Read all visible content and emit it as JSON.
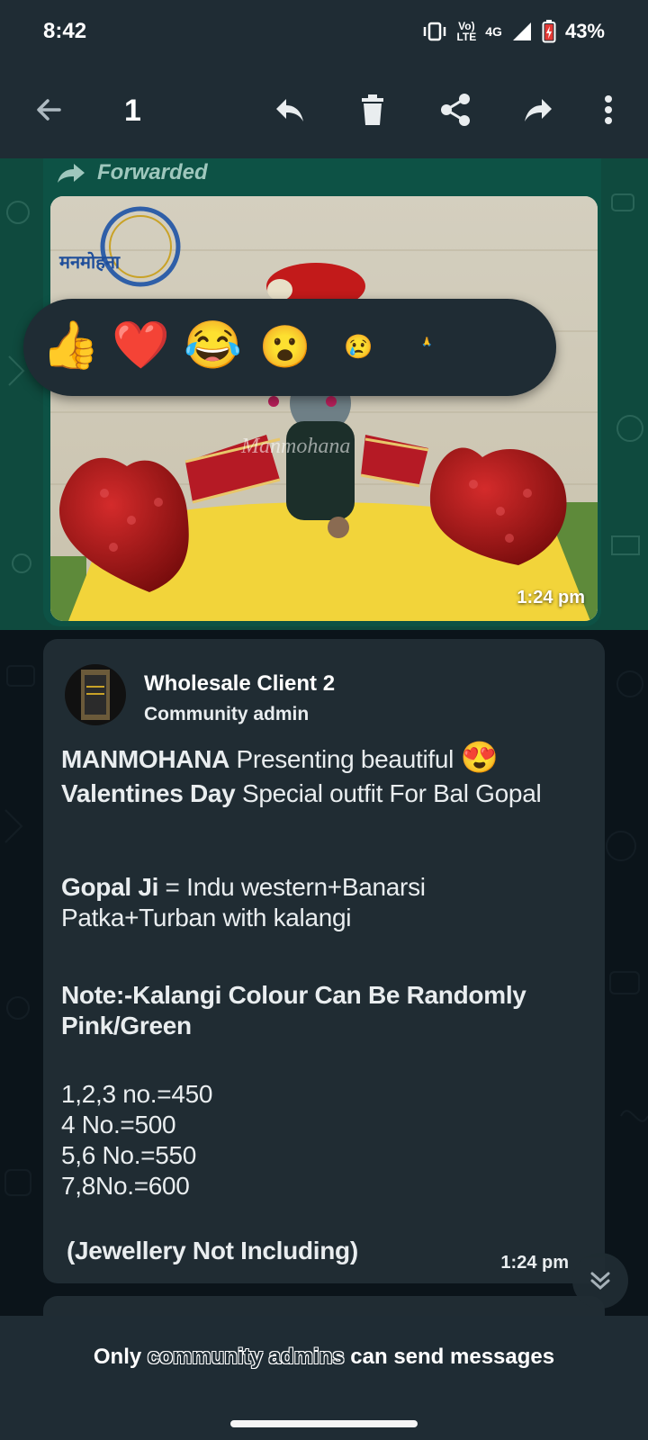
{
  "status_bar": {
    "time": "8:42",
    "network_top": "Vo)",
    "network_bottom": "LTE",
    "network_type": "4G",
    "battery": "43%"
  },
  "action_bar": {
    "selected_count": "1",
    "icons": [
      "back-arrow-icon",
      "reply-icon",
      "delete-icon",
      "share-icon",
      "forward-icon",
      "more-vert-icon"
    ]
  },
  "forwarded_message": {
    "label": "Forwarded",
    "time": "1:24 pm",
    "watermark": "Manmohana",
    "logo_text": "मनमोहना"
  },
  "reactions": [
    "👍",
    "❤️",
    "😂",
    "😮",
    "😢",
    "🙏"
  ],
  "message": {
    "sender": "Wholesale Client 2",
    "role": "Community admin",
    "line1_bold": "MANMOHANA",
    "line1_rest": " Presenting beautiful",
    "line1_emoji": "😍",
    "line2_bold": "Valentines Day",
    "line2_rest": " Special outfit For Bal Gopal",
    "line3_bold": "Gopal Ji",
    "line3_rest": " = Indu western+Banarsi",
    "line4": "Patka+Turban with kalangi",
    "note_line1": "Note:-Kalangi Colour Can Be Randomly",
    "note_line2": "Pink/Green",
    "price1": "1,2,3 no.=450",
    "price2": "4 No.=500",
    "price3": "5,6 No.=550",
    "price4": "7,8No.=600",
    "footer": "(Jewellery Not Including)",
    "time": "1:24 pm"
  },
  "bottom_info": {
    "prefix": "Only",
    "highlight1": "community",
    "highlight2": "admins",
    "suffix": "can send messages"
  },
  "colors": {
    "header": "#1f2c34",
    "chat_background": "#0b141a",
    "incoming_bubble": "#202c33",
    "selected_overlay": "#0f4a3e"
  }
}
